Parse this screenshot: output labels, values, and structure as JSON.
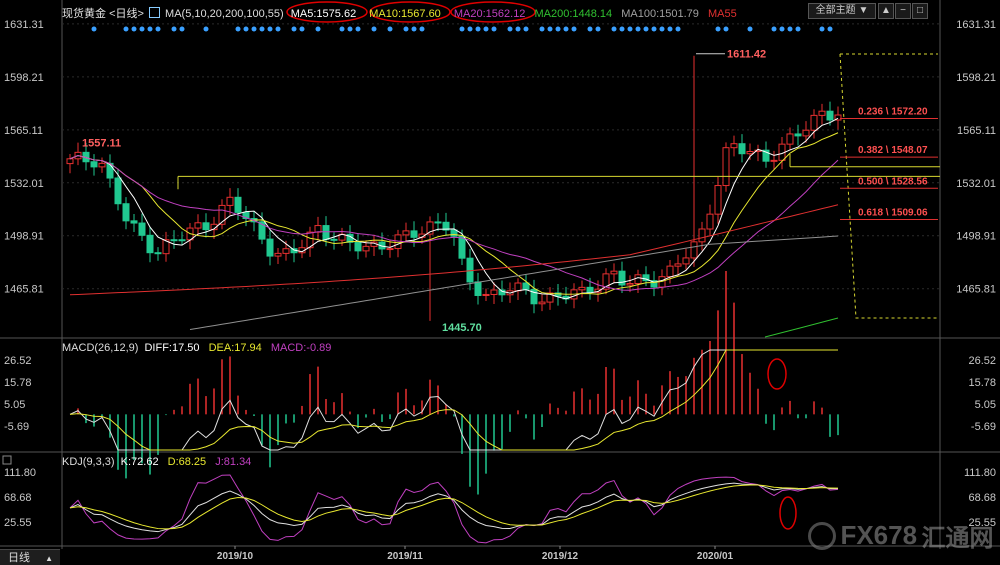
{
  "header": {
    "symbol": "现货黄金",
    "period": "<日线>",
    "ma_params": "MA(5,10,20,200,100,55)",
    "ma5": "MA5:1575.62",
    "ma10": "MA10:1567.60",
    "ma20": "MA20:1562.12",
    "ma200": "MA200:1448.14",
    "ma100": "MA100:1501.79",
    "ma55": "MA55",
    "theme_button": "全部主题",
    "colors": {
      "ma5": "#ffffff",
      "ma10": "#e8e830",
      "ma20": "#c040c0",
      "ma200": "#30c030",
      "ma100": "#909090",
      "ma55": "#e03030",
      "up": "#e83030",
      "down": "#20c890"
    }
  },
  "main_axis": {
    "ticks": [
      "1631.31",
      "1598.21",
      "1565.11",
      "1532.01",
      "1498.91",
      "1465.81"
    ],
    "ylim": [
      1440,
      1640
    ]
  },
  "annotations": {
    "high_label": "1611.42",
    "low_label": "1445.70",
    "left_high_label": "1557.11"
  },
  "fibonacci": [
    {
      "label": "0.236 \\ 1572.20",
      "value": 1572.2
    },
    {
      "label": "0.382 \\ 1548.07",
      "value": 1548.07
    },
    {
      "label": "0.500 \\ 1528.56",
      "value": 1528.56
    },
    {
      "label": "0.618 \\ 1509.06",
      "value": 1509.06
    }
  ],
  "macd": {
    "title": "MACD(26,12,9)",
    "diff": "DIFF:17.50",
    "dea": "DEA:17.94",
    "macd": "MACD:-0.89",
    "ticks": [
      "26.52",
      "15.78",
      "5.05",
      "-5.69"
    ]
  },
  "kdj": {
    "title": "KDJ(9,3,3)",
    "k": "K:72.62",
    "d": "D:68.25",
    "j": "J:81.34",
    "ticks": [
      "111.80",
      "68.68",
      "25.55"
    ]
  },
  "x_axis": {
    "period_tab": "日线",
    "labels": [
      "2019/10",
      "2019/11",
      "2019/12",
      "2020/01"
    ]
  },
  "watermark": {
    "brand": "FX678",
    "cn": "汇通网"
  },
  "chart_data": {
    "type": "candlestick",
    "x": [
      "2019-09-03",
      "2020-01-17"
    ],
    "series": [
      {
        "name": "现货黄金"
      }
    ]
  }
}
